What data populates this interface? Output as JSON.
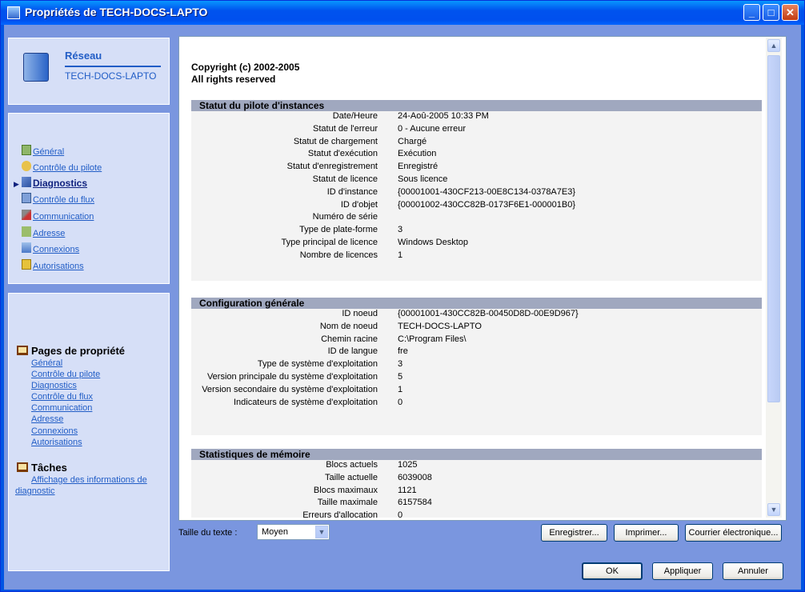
{
  "window": {
    "title": "Propriétés de TECH-DOCS-LAPTO"
  },
  "header_panel": {
    "category": "Réseau",
    "machine": "TECH-DOCS-LAPTO"
  },
  "nav": [
    {
      "label": "Général",
      "icon": "document-icon",
      "active": false
    },
    {
      "label": "Contrôle du pilote",
      "icon": "driver-control-icon",
      "active": false
    },
    {
      "label": "Diagnostics",
      "icon": "diagnostics-icon",
      "active": true
    },
    {
      "label": "Contrôle du flux",
      "icon": "flow-control-icon",
      "active": false
    },
    {
      "label": "Communication",
      "icon": "tools-icon",
      "active": false
    },
    {
      "label": "Adresse",
      "icon": "address-icon",
      "active": false
    },
    {
      "label": "Connexions",
      "icon": "connections-icon",
      "active": false
    },
    {
      "label": "Autorisations",
      "icon": "lock-icon",
      "active": false
    }
  ],
  "tasks_panel": {
    "pages_title": "Pages de propriété",
    "pages": [
      "Général",
      "Contrôle du pilote",
      "Diagnostics",
      "Contrôle du flux",
      "Communication",
      "Adresse",
      "Connexions",
      "Autorisations"
    ],
    "tasks_title": "Tâches",
    "task_line1": "Affichage des informations de",
    "task_line2": "diagnostic"
  },
  "doc": {
    "copyright": "Copyright (c) 2002-2005",
    "rights": "All rights reserved",
    "sections": [
      {
        "title": "Statut du pilote d'instances",
        "rows": [
          {
            "k": "Date/Heure",
            "v": "24-Aoû-2005 10:33 PM"
          },
          {
            "k": "Statut de l'erreur",
            "v": "0 - Aucune erreur"
          },
          {
            "k": "Statut de chargement",
            "v": "Chargé"
          },
          {
            "k": "Statut d'exécution",
            "v": "Exécution"
          },
          {
            "k": "Statut d'enregistrement",
            "v": "Enregistré"
          },
          {
            "k": "Statut de licence",
            "v": "Sous licence"
          },
          {
            "k": "ID d'instance",
            "v": "{00001001-430CF213-00E8C134-0378A7E3}"
          },
          {
            "k": "ID d'objet",
            "v": "{00001002-430CC82B-0173F6E1-000001B0}"
          },
          {
            "k": "Numéro de série",
            "v": ""
          },
          {
            "k": "Type de plate-forme",
            "v": "3"
          },
          {
            "k": "Type principal de licence",
            "v": "Windows Desktop"
          },
          {
            "k": "Nombre de licences",
            "v": "1"
          }
        ]
      },
      {
        "title": "Configuration générale",
        "rows": [
          {
            "k": "ID noeud",
            "v": "{00001001-430CC82B-00450D8D-00E9D967}"
          },
          {
            "k": "Nom de noeud",
            "v": "TECH-DOCS-LAPTO"
          },
          {
            "k": "Chemin racine",
            "v": "C:\\Program Files\\"
          },
          {
            "k": "ID de langue",
            "v": "fre"
          },
          {
            "k": "Type de système d'exploitation",
            "v": "3"
          },
          {
            "k": "Version principale du système d'exploitation",
            "v": "5"
          },
          {
            "k": "Version secondaire du système d'exploitation",
            "v": "1"
          },
          {
            "k": "Indicateurs de système d'exploitation",
            "v": "0"
          }
        ]
      },
      {
        "title": "Statistiques de mémoire",
        "rows": [
          {
            "k": "Blocs actuels",
            "v": "1025"
          },
          {
            "k": "Taille actuelle",
            "v": "6039008"
          },
          {
            "k": "Blocs maximaux",
            "v": "1121"
          },
          {
            "k": "Taille maximale",
            "v": "6157584"
          },
          {
            "k": "Erreurs d'allocation",
            "v": "0"
          }
        ]
      }
    ]
  },
  "footer": {
    "text_size_label": "Taille du texte :",
    "text_size_value": "Moyen",
    "save": "Enregistrer...",
    "print": "Imprimer...",
    "email": "Courrier électronique...",
    "ok": "OK",
    "apply": "Appliquer",
    "cancel": "Annuler"
  }
}
